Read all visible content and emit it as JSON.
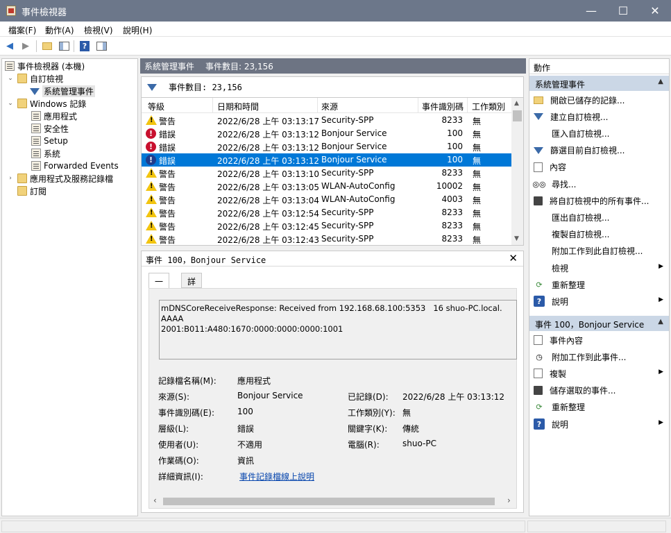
{
  "window": {
    "title": "事件檢視器",
    "minimize_glyph": "—",
    "maximize_glyph": "☐",
    "close_glyph": "✕"
  },
  "menu": [
    "檔案(F)",
    "動作(A)",
    "檢視(V)",
    "說明(H)"
  ],
  "toolbar": {
    "icons": [
      "back-arrow-icon",
      "forward-arrow-icon",
      "folder-up-icon",
      "show-hide-tree-icon",
      "help-icon",
      "show-hide-action-pane-icon"
    ]
  },
  "tree": {
    "root": "事件檢視器 (本機)",
    "custom_views": "自訂檢視",
    "admin_events": "系統管理事件",
    "windows_logs": "Windows 記錄",
    "logs": [
      "應用程式",
      "安全性",
      "Setup",
      "系統",
      "Forwarded Events"
    ],
    "app_service_logs": "應用程式及服務記錄檔",
    "subscriptions": "訂閱"
  },
  "middle": {
    "header_title": "系統管理事件",
    "header_count": "事件數目: 23,156",
    "filter_text": "事件數目: 23,156",
    "columns": [
      "等級",
      "日期和時間",
      "來源",
      "事件識別碼",
      "工作類別"
    ],
    "rows": [
      {
        "level": "警告",
        "type": "warning",
        "datetime": "2022/6/28 上午 03:13:17",
        "source": "Security-SPP",
        "id": "8233",
        "category": "無"
      },
      {
        "level": "錯誤",
        "type": "error",
        "datetime": "2022/6/28 上午 03:13:12",
        "source": "Bonjour Service",
        "id": "100",
        "category": "無"
      },
      {
        "level": "錯誤",
        "type": "error",
        "datetime": "2022/6/28 上午 03:13:12",
        "source": "Bonjour Service",
        "id": "100",
        "category": "無"
      },
      {
        "level": "錯誤",
        "type": "error",
        "datetime": "2022/6/28 上午 03:13:12",
        "source": "Bonjour Service",
        "id": "100",
        "category": "無",
        "selected": true
      },
      {
        "level": "警告",
        "type": "warning",
        "datetime": "2022/6/28 上午 03:13:10",
        "source": "Security-SPP",
        "id": "8233",
        "category": "無"
      },
      {
        "level": "警告",
        "type": "warning",
        "datetime": "2022/6/28 上午 03:13:05",
        "source": "WLAN-AutoConfig",
        "id": "10002",
        "category": "無"
      },
      {
        "level": "警告",
        "type": "warning",
        "datetime": "2022/6/28 上午 03:13:04",
        "source": "WLAN-AutoConfig",
        "id": "4003",
        "category": "無"
      },
      {
        "level": "警告",
        "type": "warning",
        "datetime": "2022/6/28 上午 03:12:54",
        "source": "Security-SPP",
        "id": "8233",
        "category": "無"
      },
      {
        "level": "警告",
        "type": "warning",
        "datetime": "2022/6/28 上午 03:12:45",
        "source": "Security-SPP",
        "id": "8233",
        "category": "無"
      },
      {
        "level": "警告",
        "type": "warning",
        "datetime": "2022/6/28 上午 03:12:43",
        "source": "Security-SPP",
        "id": "8233",
        "category": "無"
      }
    ]
  },
  "detail": {
    "title": "事件 100，Bonjour Service",
    "close_glyph": "✕",
    "tabs": [
      "一般",
      "詳細資料"
    ],
    "message": "mDNSCoreReceiveResponse: Received from 192.168.68.100:5353   16 shuo-PC.local. AAAA\n2001:B011:A480:1670:0000:0000:0000:1001",
    "labels": {
      "log_name": "記錄檔名稱(M):",
      "source": "來源(S):",
      "event_id": "事件識別碼(E):",
      "level": "層級(L):",
      "user": "使用者(U):",
      "opcode": "作業碼(O):",
      "more_info": "詳細資訊(I):",
      "logged": "已記錄(D):",
      "task_category": "工作類別(Y):",
      "keywords": "關鍵字(K):",
      "computer": "電腦(R):"
    },
    "values": {
      "log_name": "應用程式",
      "source": "Bonjour Service",
      "event_id": "100",
      "level": "錯誤",
      "user": "不適用",
      "opcode": "資訊",
      "more_info": "事件記錄檔線上說明",
      "logged": "2022/6/28 上午 03:13:12",
      "task_category": "無",
      "keywords": "傳統",
      "computer": "shuo-PC"
    }
  },
  "actions": {
    "title": "動作",
    "section1": "系統管理事件",
    "section1_items": [
      {
        "label": "開啟已儲存的記錄...",
        "icon": "open-folder-icon",
        "submenu": false
      },
      {
        "label": "建立自訂檢視...",
        "icon": "create-view-filter-icon",
        "submenu": false
      },
      {
        "label": "匯入自訂檢視...",
        "icon": "import-view-icon",
        "submenu": false
      },
      {
        "label": "篩選目前自訂檢視...",
        "icon": "filter-icon",
        "submenu": false
      },
      {
        "label": "內容",
        "icon": "properties-icon",
        "submenu": false
      },
      {
        "label": "尋找...",
        "icon": "binoculars-icon",
        "submenu": false
      },
      {
        "label": "將自訂檢視中的所有事件...",
        "icon": "save-icon",
        "submenu": false
      },
      {
        "label": "匯出自訂檢視...",
        "icon": "export-view-icon",
        "submenu": false
      },
      {
        "label": "複製自訂檢視...",
        "icon": "copy-view-icon",
        "submenu": false
      },
      {
        "label": "附加工作到此自訂檢視...",
        "icon": "attach-task-icon",
        "submenu": false
      },
      {
        "label": "檢視",
        "icon": "view-icon",
        "submenu": true
      },
      {
        "label": "重新整理",
        "icon": "refresh-icon",
        "submenu": false
      },
      {
        "label": "說明",
        "icon": "help-icon",
        "submenu": true
      }
    ],
    "section2": "事件 100，Bonjour Service",
    "section2_items": [
      {
        "label": "事件內容",
        "icon": "event-properties-icon",
        "submenu": false
      },
      {
        "label": "附加工作到此事件...",
        "icon": "attach-task-clock-icon",
        "submenu": false
      },
      {
        "label": "複製",
        "icon": "copy-icon",
        "submenu": true
      },
      {
        "label": "儲存選取的事件...",
        "icon": "save-icon",
        "submenu": false
      },
      {
        "label": "重新整理",
        "icon": "refresh-icon",
        "submenu": false
      },
      {
        "label": "說明",
        "icon": "help-icon",
        "submenu": true
      }
    ]
  },
  "colors": {
    "titlebar": "#6c778a",
    "selection": "#0078d7",
    "section_header": "#cbd7e6",
    "error": "#c8102e",
    "warning": "#f2c40f",
    "link": "#0645ad"
  }
}
